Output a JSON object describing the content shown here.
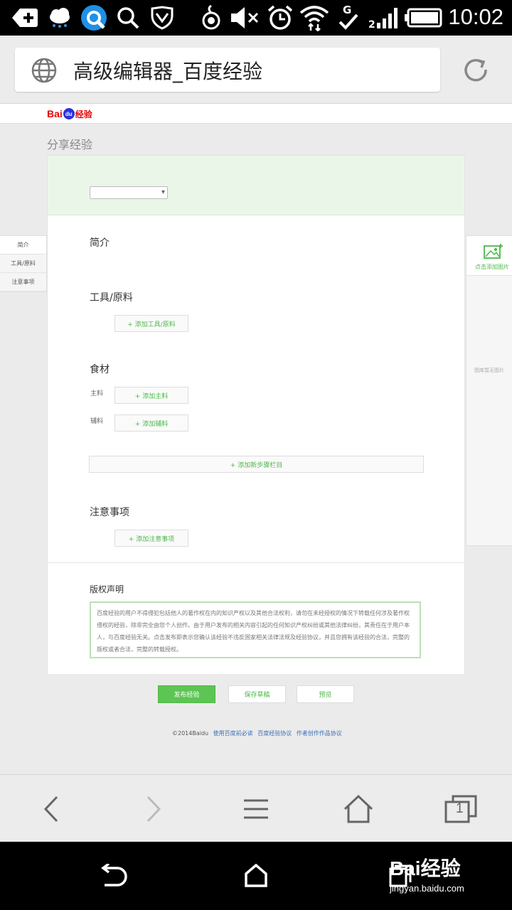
{
  "status_bar": {
    "time": "10:02",
    "icons": [
      "add-notification-icon",
      "weather-cloud-icon",
      "browser-q-icon",
      "search-icon",
      "shield-icon",
      "nfc-icon",
      "mute-icon",
      "alarm-icon",
      "wifi-icon",
      "mobile-data-g-icon",
      "signal-icon",
      "battery-icon"
    ]
  },
  "browser": {
    "page_title": "高级编辑器_百度经验",
    "globe_icon": "globe-icon",
    "reload_icon": "reload-icon"
  },
  "page": {
    "logo": {
      "bai": "Bai",
      "du": "du",
      "jingyan": "经验"
    },
    "share_title": "分享经验",
    "category_select": {
      "value": ""
    },
    "sections": {
      "intro": "简介",
      "tools": "工具/原料",
      "ingredients": "食材",
      "notes": "注意事项",
      "copyright": "版权声明"
    },
    "buttons": {
      "add_tool": "+ 添加工具/原料",
      "add_main": "+ 添加主料",
      "add_aux": "+ 添加辅料",
      "add_step_section": "+ 添加新步骤栏目",
      "add_note": "+ 添加注意事项",
      "publish": "发布经验",
      "save_draft": "保存草稿",
      "preview": "预览"
    },
    "labels": {
      "main_ingredient": "主料",
      "aux_ingredient": "辅料"
    },
    "copyright_text": "百度经验的用户不得侵犯包括他人的著作权在内的知识产权以及其他合法权利，请勿在未经授权的情况下转载任何涉及著作权侵权的经验，除非完全由您个人创作。由于用户发布的相关内容引起的任何知识产权纠纷或其他法律纠纷，其责任在于用户本人，与百度经验无关。点击发布即表示您确认该经验不违反国家相关法律法规及经验协议，并且您拥有该经验的合法，完整的版权或者合法，完整的转载授权。",
    "left_nav": [
      "简介",
      "工具/原料",
      "注意事项"
    ],
    "right_panel": {
      "add_image": "点击添加图片",
      "empty": "图库暂无图片"
    },
    "footer": {
      "copyright": "©2014Baidu",
      "links": [
        "使用百度前必读",
        "百度经验协议",
        "作者创作作品协议"
      ]
    }
  },
  "toolbar": {
    "icons": [
      "back-icon",
      "forward-icon",
      "menu-icon",
      "home-icon",
      "tabs-icon"
    ],
    "tab_count": "1"
  },
  "navbar": {
    "icons": [
      "android-back-icon",
      "android-home-icon",
      "android-recents-icon"
    ]
  },
  "watermark": {
    "logo": "Bai经验",
    "url": "jingyan.baidu.com"
  },
  "colors": {
    "accent_green": "#5cc553",
    "link_blue": "#3b6fb6",
    "baidu_red": "#e10601",
    "baidu_blue": "#2932e1"
  }
}
